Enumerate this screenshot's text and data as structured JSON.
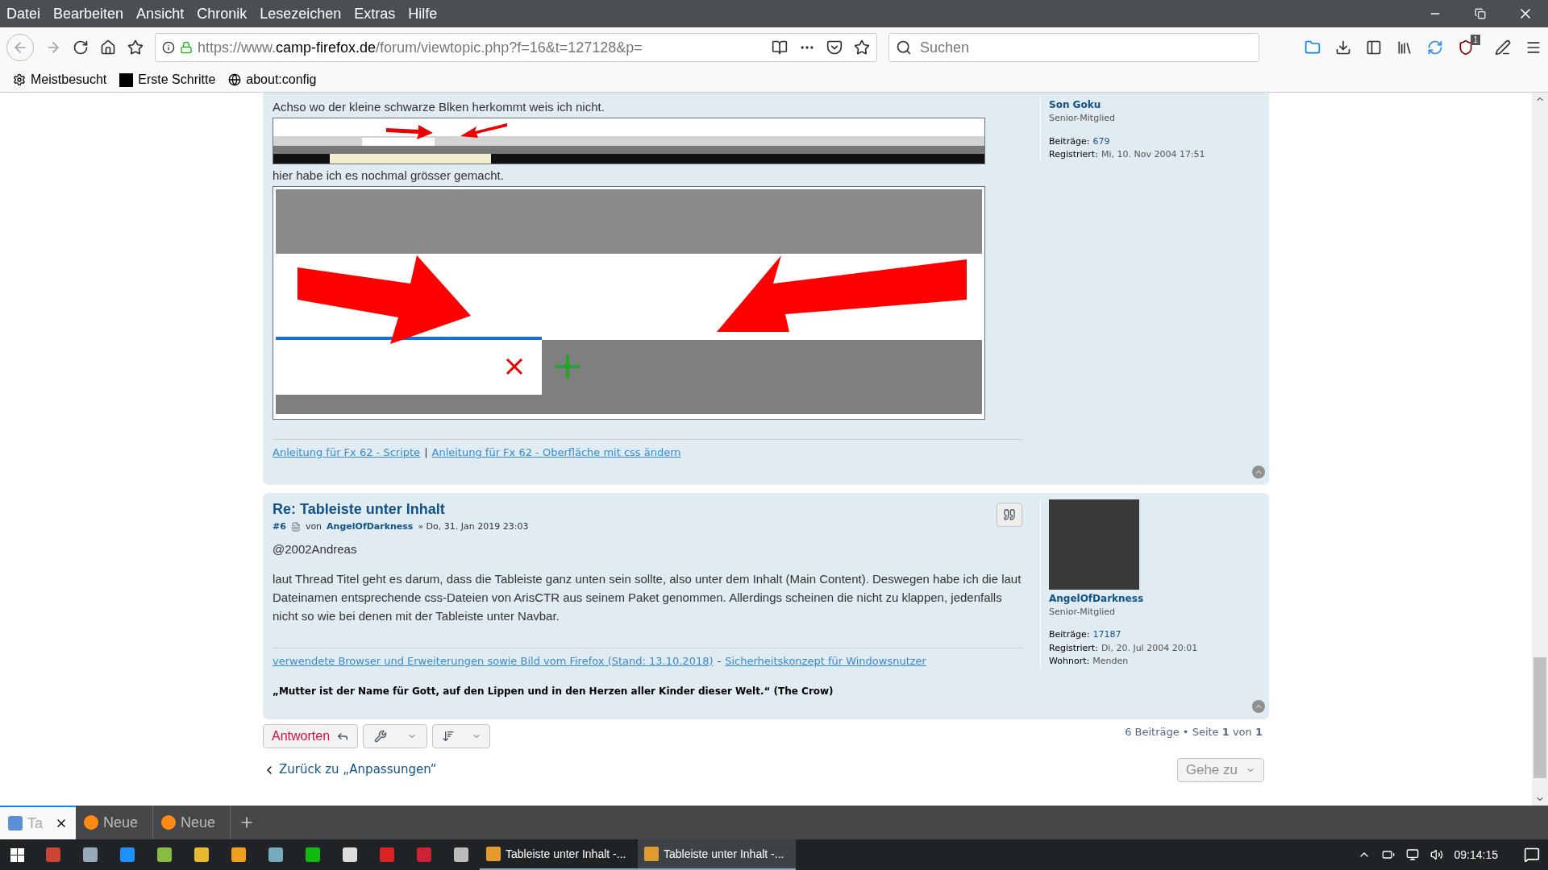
{
  "menu_bar": [
    "Datei",
    "Bearbeiten",
    "Ansicht",
    "Chronik",
    "Lesezeichen",
    "Extras",
    "Hilfe"
  ],
  "toolbar": {
    "url_prefix": "https://www.",
    "url_host": "camp-firefox.de",
    "url_path": "/forum/viewtopic.php?f=16&t=127128&p=",
    "search_placeholder": "Suchen",
    "badge": "1"
  },
  "bookmarks": [
    "Meistbesucht",
    "Erste Schritte",
    "about:config"
  ],
  "posts": [
    {
      "body": [
        {
          "kind": "text",
          "text": "Achso wo der kleine schwarze Blken herkommt weis ich nicht."
        },
        {
          "kind": "thumbnail"
        },
        {
          "kind": "text",
          "text": "hier habe ich es nochmal grösser gemacht."
        },
        {
          "kind": "image"
        }
      ],
      "signature_links": [
        "Anleitung für Fx 62 - Scripte",
        "Anleitung für Fx 62 - Oberfläche mit css ändern"
      ],
      "signature_separator": "|",
      "profile": {
        "name": "Son Goku",
        "rank": "Senior-Mitglied",
        "avatar": false,
        "fields": [
          {
            "label": "Beiträge:",
            "value": "679",
            "kind": "link"
          },
          {
            "label": "Registriert:",
            "value": "Mi, 10. Nov 2004 17:51",
            "kind": "text"
          }
        ]
      }
    },
    {
      "title": "Re: Tableiste unter Inhalt",
      "number": "#6",
      "by": "von",
      "author": "AngelOfDarkness",
      "date": "» Do, 31. Jan 2019 23:03",
      "body": [
        {
          "kind": "text",
          "text": "@2002Andreas"
        },
        {
          "kind": "text",
          "text": "laut Thread Titel geht es darum, dass die Tableiste ganz unten sein sollte, also unter dem Inhalt (Main Content). Deswegen habe ich die laut Dateinamen entsprechende css-Dateien von ArisCTR aus seinem Paket genommen. Allerdings scheinen die nicht zu klappen, jedenfalls nicht so wie bei denen mit der Tableiste unter Navbar."
        }
      ],
      "signature_links": [
        "verwendete Browser und Erweiterungen sowie Bild vom Firefox (Stand: 13.10.2018)",
        "Sicherheitskonzept für Windowsnutzer"
      ],
      "signature_separator": "-",
      "quote": "„Mutter ist der Name für Gott, auf den Lippen und in den Herzen aller Kinder dieser Welt.“ (The Crow)",
      "profile": {
        "name": "AngelOfDarkness",
        "rank": "Senior-Mitglied",
        "avatar": true,
        "fields": [
          {
            "label": "Beiträge:",
            "value": "17187",
            "kind": "link"
          },
          {
            "label": "Registriert:",
            "value": "Di, 20. Jul 2004 20:01",
            "kind": "text"
          },
          {
            "label": "Wohnort:",
            "value": "Menden",
            "kind": "text"
          }
        ]
      }
    }
  ],
  "actions": {
    "reply": "Antworten",
    "pagination": "6 Beiträge • Seite **1** von **1**",
    "back": "Zurück zu „Anpassungen“",
    "jump": "Gehe zu"
  },
  "tabs": [
    {
      "label": "Ta",
      "selected": true
    },
    {
      "label": "Neue",
      "selected": false
    },
    {
      "label": "Neue",
      "selected": false
    }
  ],
  "taskbar": {
    "windows": [
      {
        "label": "Tableiste unter Inhalt -...",
        "selected": false
      },
      {
        "label": "Tableiste unter Inhalt -...",
        "selected": true
      }
    ],
    "clock": "09:14:15"
  }
}
